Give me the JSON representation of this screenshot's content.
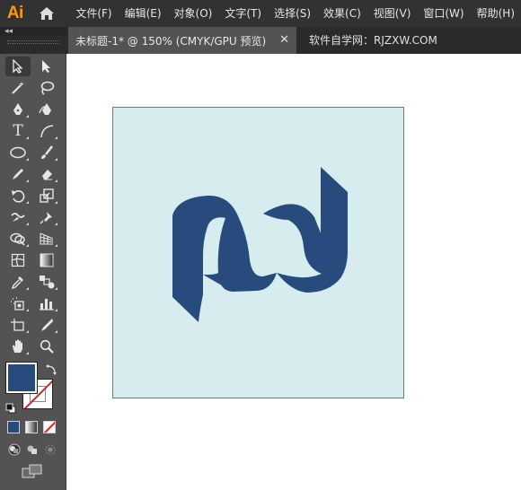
{
  "app": {
    "logo_text": "Ai",
    "home_icon": "home-icon"
  },
  "menu": [
    {
      "label": "文件(F)"
    },
    {
      "label": "编辑(E)"
    },
    {
      "label": "对象(O)"
    },
    {
      "label": "文字(T)"
    },
    {
      "label": "选择(S)"
    },
    {
      "label": "效果(C)"
    },
    {
      "label": "视图(V)"
    },
    {
      "label": "窗口(W)"
    },
    {
      "label": "帮助(H)"
    }
  ],
  "tabs": {
    "collapse_label": "◂◂",
    "document_title": "未标题-1* @ 150% (CMYK/GPU 预览)",
    "close_label": "✕",
    "site_text": "软件自学网：RJZXW.COM"
  },
  "tools": {
    "type_glyph": "T",
    "icons": [
      "selection-tool-icon",
      "direct-selection-tool-icon",
      "magic-wand-tool-icon",
      "lasso-tool-icon",
      "pen-tool-icon",
      "curvature-tool-icon",
      "type-tool-icon",
      "line-segment-tool-icon",
      "ellipse-tool-icon",
      "paintbrush-tool-icon",
      "pencil-tool-icon",
      "eraser-tool-icon",
      "rotate-tool-icon",
      "scale-tool-icon",
      "warp-tool-icon",
      "puppet-warp-tool-icon",
      "shape-builder-tool-icon",
      "perspective-grid-tool-icon",
      "mesh-tool-icon",
      "gradient-tool-icon",
      "eyedropper-tool-icon",
      "blend-tool-icon",
      "symbol-sprayer-tool-icon",
      "column-graph-tool-icon",
      "artboard-tool-icon",
      "slice-tool-icon",
      "hand-tool-icon",
      "zoom-tool-icon"
    ]
  },
  "colors": {
    "fill": "#284b7e",
    "stroke": "none",
    "artboard_bg": "#d7ecef",
    "logo": "#284b7e",
    "ui_dark": "#323232",
    "panel": "#535353"
  }
}
